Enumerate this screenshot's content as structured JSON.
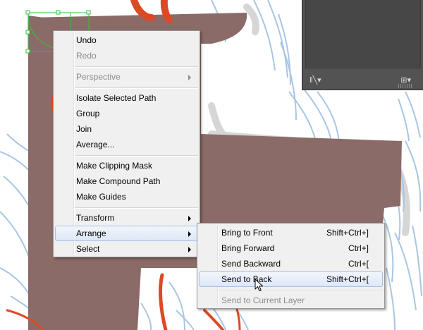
{
  "context_menu": {
    "items": [
      {
        "label": "Undo",
        "enabled": true
      },
      {
        "label": "Redo",
        "enabled": false
      },
      {
        "label": "Perspective",
        "enabled": false,
        "submenu": true
      },
      {
        "label": "Isolate Selected Path",
        "enabled": true
      },
      {
        "label": "Group",
        "enabled": true
      },
      {
        "label": "Join",
        "enabled": true
      },
      {
        "label": "Average...",
        "enabled": true
      },
      {
        "label": "Make Clipping Mask",
        "enabled": true
      },
      {
        "label": "Make Compound Path",
        "enabled": true
      },
      {
        "label": "Make Guides",
        "enabled": true
      },
      {
        "label": "Transform",
        "enabled": true,
        "submenu": true
      },
      {
        "label": "Arrange",
        "enabled": true,
        "submenu": true,
        "highlighted": true
      },
      {
        "label": "Select",
        "enabled": true,
        "submenu": true
      }
    ]
  },
  "arrange_submenu": {
    "items": [
      {
        "label": "Bring to Front",
        "shortcut": "Shift+Ctrl+]",
        "enabled": true
      },
      {
        "label": "Bring Forward",
        "shortcut": "Ctrl+]",
        "enabled": true
      },
      {
        "label": "Send Backward",
        "shortcut": "Ctrl+[",
        "enabled": true
      },
      {
        "label": "Send to Back",
        "shortcut": "Shift+Ctrl+[",
        "enabled": true,
        "highlighted": true
      },
      {
        "label": "Send to Current Layer",
        "enabled": false
      }
    ]
  },
  "colors": {
    "reindeer_body": "#8a6b67",
    "antler_orange": "#dc4a25",
    "sketch_blue": "#a9c6e4",
    "selection_green": "#35c23a",
    "panel_dark": "#525252",
    "menu_highlight_border": "#a9c0e3"
  },
  "icons": {
    "panel_library": "library-icon",
    "panel_menu": "panel-options-icon",
    "cursor": "arrow-cursor-icon"
  }
}
